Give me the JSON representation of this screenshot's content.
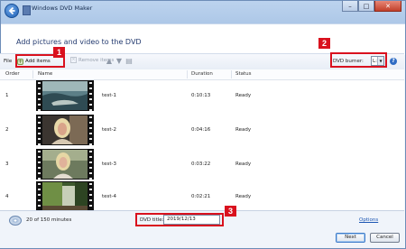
{
  "window": {
    "title": "Windows DVD Maker",
    "heading": "Add pictures and video to the DVD",
    "caption": {
      "minimize": "–",
      "maximize": "□",
      "close": "✕"
    }
  },
  "toolbar": {
    "file_label": "File",
    "add_items_label": "Add items",
    "remove_items_label": "Remove items",
    "dvd_burner_label": "DVD burner:",
    "dvd_burner_value": "L:",
    "help_glyph": "?"
  },
  "callouts": [
    "1",
    "2",
    "3"
  ],
  "table": {
    "columns": [
      "Order",
      "Name",
      "Duration",
      "Status"
    ],
    "rows": [
      {
        "order": "1",
        "name": "test-1",
        "duration": "0:10:13",
        "status": "Ready"
      },
      {
        "order": "2",
        "name": "test-2",
        "duration": "0:04:16",
        "status": "Ready"
      },
      {
        "order": "3",
        "name": "test-3",
        "duration": "0:03:22",
        "status": "Ready"
      },
      {
        "order": "4",
        "name": "test-4",
        "duration": "0:02:21",
        "status": "Ready"
      }
    ]
  },
  "footer": {
    "minutes": "20 of 150 minutes",
    "dvd_title_label": "DVD title:",
    "dvd_title_value": "2019/12/13",
    "options_link": "Options",
    "next_button": "Next",
    "cancel_button": "Cancel"
  },
  "colors": {
    "callout_red": "#d9111e",
    "link_blue": "#1c56b3",
    "heading_blue": "#243b70"
  }
}
